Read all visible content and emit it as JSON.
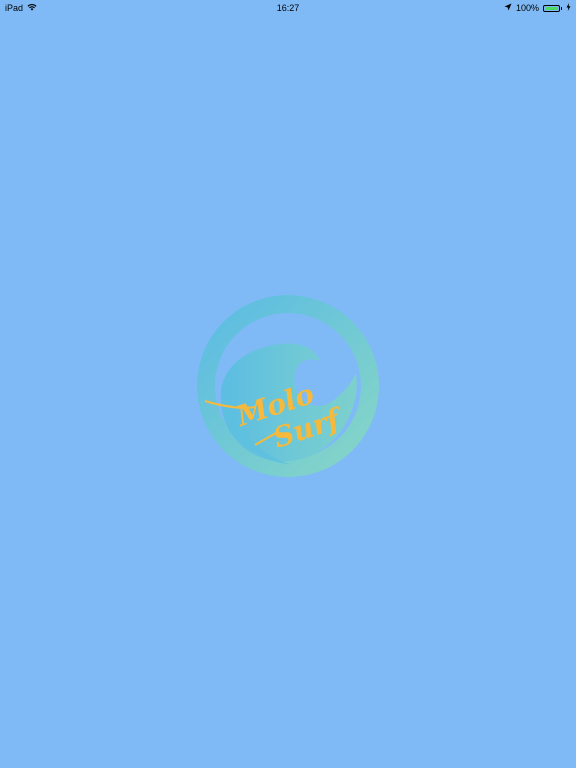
{
  "status_bar": {
    "device": "iPad",
    "time": "16:27",
    "battery_percent": "100%",
    "battery_level": 1.0,
    "icons": [
      "wifi-icon",
      "location-icon",
      "battery-icon",
      "charging-icon"
    ]
  },
  "logo": {
    "line1": "Molo",
    "line2": "Surf",
    "colors": {
      "circle_start": "#5bbbe3",
      "circle_end": "#86d6c6",
      "text": "#f6b93b"
    }
  },
  "colors": {
    "background": "#7fbaf7"
  }
}
